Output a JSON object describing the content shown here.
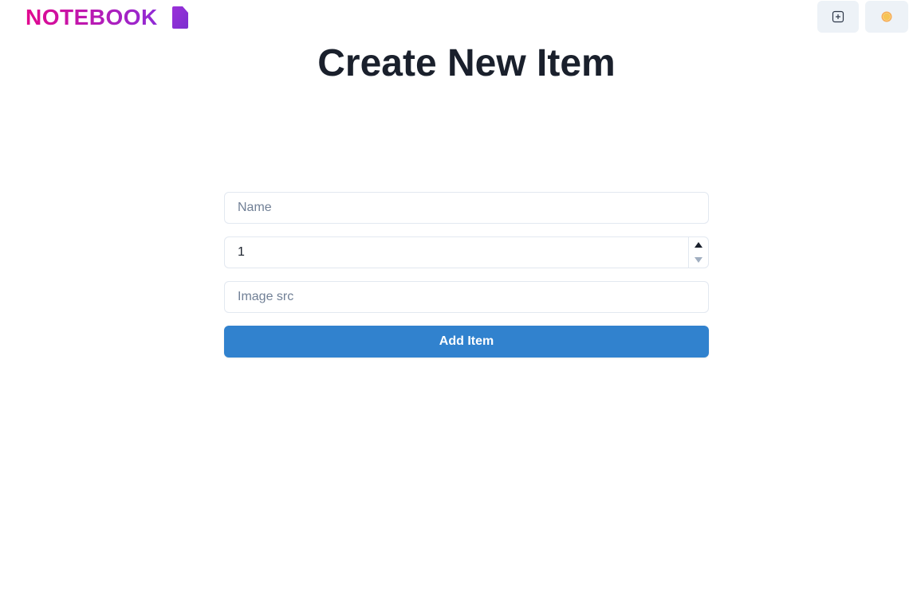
{
  "brand": {
    "name": "NOTEBOOK",
    "icon": "file-icon",
    "gradient_start": "#e3088f",
    "gradient_end": "#8f2bd6"
  },
  "nav": {
    "add_icon": "plus-square-icon",
    "theme_icon": "sun-icon"
  },
  "page": {
    "title": "Create New Item"
  },
  "form": {
    "name_placeholder": "Name",
    "name_value": "",
    "quantity_value": "1",
    "image_placeholder": "Image src",
    "image_value": "",
    "submit_label": "Add Item"
  },
  "colors": {
    "accent": "#3182ce",
    "nav_button_bg": "#edf2f7",
    "sun": "#f6ad55"
  }
}
